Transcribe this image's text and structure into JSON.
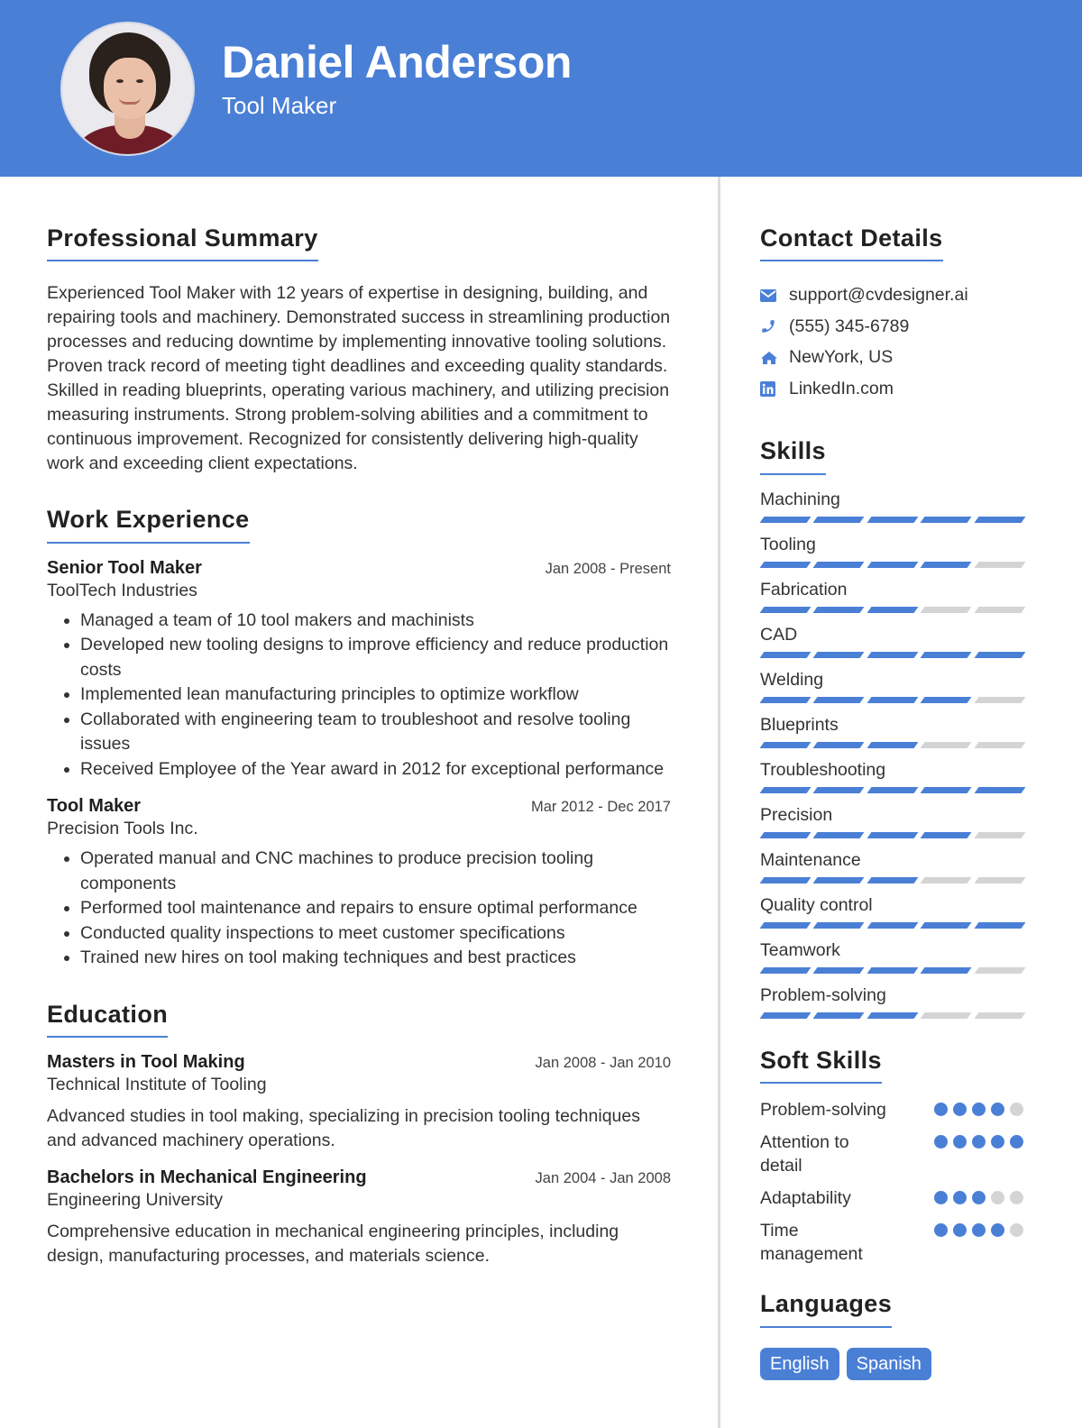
{
  "header": {
    "name": "Daniel Anderson",
    "role": "Tool Maker",
    "accent_color": "#4a7fd6"
  },
  "summary": {
    "title": "Professional Summary",
    "text": "Experienced Tool Maker with 12 years of expertise in designing, building, and repairing tools and machinery. Demonstrated success in streamlining production processes and reducing downtime by implementing innovative tooling solutions. Proven track record of meeting tight deadlines and exceeding quality standards. Skilled in reading blueprints, operating various machinery, and utilizing precision measuring instruments. Strong problem-solving abilities and a commitment to continuous improvement. Recognized for consistently delivering high-quality work and exceeding client expectations."
  },
  "experience": {
    "title": "Work Experience",
    "jobs": [
      {
        "title": "Senior Tool Maker",
        "date": "Jan 2008 - Present",
        "company": "ToolTech Industries",
        "bullets": [
          "Managed a team of 10 tool makers and machinists",
          "Developed new tooling designs to improve efficiency and reduce production costs",
          "Implemented lean manufacturing principles to optimize workflow",
          "Collaborated with engineering team to troubleshoot and resolve tooling issues",
          "Received Employee of the Year award in 2012 for exceptional performance"
        ]
      },
      {
        "title": "Tool Maker",
        "date": "Mar 2012 - Dec 2017",
        "company": "Precision Tools Inc.",
        "bullets": [
          "Operated manual and CNC machines to produce precision tooling components",
          "Performed tool maintenance and repairs to ensure optimal performance",
          "Conducted quality inspections to meet customer specifications",
          "Trained new hires on tool making techniques and best practices"
        ]
      }
    ]
  },
  "education": {
    "title": "Education",
    "items": [
      {
        "degree": "Masters in Tool Making",
        "date": "Jan 2008 - Jan 2010",
        "school": "Technical Institute of Tooling",
        "description": "Advanced studies in tool making, specializing in precision tooling techniques and advanced machinery operations."
      },
      {
        "degree": "Bachelors in Mechanical Engineering",
        "date": "Jan 2004 - Jan 2008",
        "school": "Engineering University",
        "description": "Comprehensive education in mechanical engineering principles, including design, manufacturing processes, and materials science."
      }
    ]
  },
  "contact": {
    "title": "Contact Details",
    "items": [
      {
        "icon": "envelope-icon",
        "text": "support@cvdesigner.ai"
      },
      {
        "icon": "phone-icon",
        "text": "(555) 345-6789"
      },
      {
        "icon": "home-icon",
        "text": "NewYork, US"
      },
      {
        "icon": "linkedin-icon",
        "text": "LinkedIn.com"
      }
    ]
  },
  "skills": {
    "title": "Skills",
    "max": 5,
    "items": [
      {
        "name": "Machining",
        "level": 5
      },
      {
        "name": "Tooling",
        "level": 4
      },
      {
        "name": "Fabrication",
        "level": 3
      },
      {
        "name": "CAD",
        "level": 5
      },
      {
        "name": "Welding",
        "level": 4
      },
      {
        "name": "Blueprints",
        "level": 3
      },
      {
        "name": "Troubleshooting",
        "level": 5
      },
      {
        "name": "Precision",
        "level": 4
      },
      {
        "name": "Maintenance",
        "level": 3
      },
      {
        "name": "Quality control",
        "level": 5
      },
      {
        "name": "Teamwork",
        "level": 4
      },
      {
        "name": "Problem-solving",
        "level": 3
      }
    ]
  },
  "soft_skills": {
    "title": "Soft Skills",
    "max": 5,
    "items": [
      {
        "name": "Problem-solving",
        "level": 4
      },
      {
        "name": "Attention to detail",
        "level": 5
      },
      {
        "name": "Adaptability",
        "level": 3
      },
      {
        "name": "Time management",
        "level": 4
      }
    ]
  },
  "languages": {
    "title": "Languages",
    "items": [
      "English",
      "Spanish"
    ]
  }
}
